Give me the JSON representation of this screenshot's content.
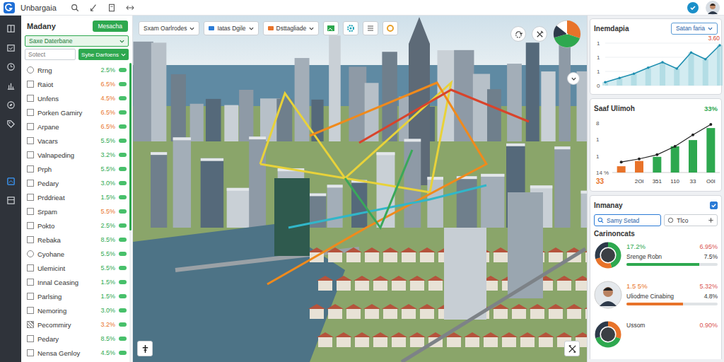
{
  "window": {
    "title": "Unbargaia"
  },
  "rail": [
    {
      "selected": false
    },
    {
      "selected": false
    },
    {
      "selected": false
    },
    {
      "selected": false
    },
    {
      "selected": false
    },
    {
      "selected": false
    },
    {
      "selected": true
    },
    {
      "selected": false
    }
  ],
  "left_panel": {
    "title": "Madany",
    "button": "Mesacha",
    "filter": "Saxe Daterbane",
    "search": {
      "placeholder": "Sotect"
    },
    "dropdown": "Sybe Darfoens",
    "scroll_level": 0.56,
    "items": [
      {
        "kind": "radio",
        "name": "Rrng",
        "value": "2.5%",
        "color": "#2ea84f",
        "checked": false
      },
      {
        "kind": "checkbox",
        "name": "Raiot",
        "value": "6.5%",
        "color": "#e8732a",
        "checked": false
      },
      {
        "kind": "checkbox",
        "name": "Unfens",
        "value": "4.5%",
        "color": "#e8732a",
        "checked": false
      },
      {
        "kind": "checkbox",
        "name": "Porken Gamiry",
        "value": "6.5%",
        "color": "#e8732a",
        "checked": false
      },
      {
        "kind": "checkbox",
        "name": "Arpane",
        "value": "6.5%",
        "color": "#e8732a",
        "checked": false
      },
      {
        "kind": "checkbox",
        "name": "Vacars",
        "value": "5.5%",
        "color": "#2ea84f",
        "checked": false
      },
      {
        "kind": "checkbox",
        "name": "Valnapeding",
        "value": "3.2%",
        "color": "#2ea84f",
        "checked": false
      },
      {
        "kind": "checkbox",
        "name": "Prph",
        "value": "5.5%",
        "color": "#2ea84f",
        "checked": false
      },
      {
        "kind": "checkbox",
        "name": "Pedary",
        "value": "3.0%",
        "color": "#2ea84f",
        "checked": false
      },
      {
        "kind": "checkbox",
        "name": "Prddrieat",
        "value": "1.5%",
        "color": "#2ea84f",
        "checked": false
      },
      {
        "kind": "checkbox",
        "name": "Srpam",
        "value": "5.5%",
        "color": "#e8732a",
        "checked": false
      },
      {
        "kind": "checkbox",
        "name": "Pokto",
        "value": "2.5%",
        "color": "#2ea84f",
        "checked": false
      },
      {
        "kind": "checkbox",
        "name": "Rebaka",
        "value": "8.5%",
        "color": "#2ea84f",
        "checked": false
      },
      {
        "kind": "radio",
        "name": "Cyohane",
        "value": "5.5%",
        "color": "#2ea84f",
        "checked": false
      },
      {
        "kind": "checkbox",
        "name": "Ulemicint",
        "value": "5.5%",
        "color": "#2ea84f",
        "checked": false
      },
      {
        "kind": "checkbox",
        "name": "Innal Ceasing",
        "value": "1.5%",
        "color": "#2ea84f",
        "checked": false
      },
      {
        "kind": "checkbox",
        "name": "Parlsing",
        "value": "1.5%",
        "color": "#2ea84f",
        "checked": false
      },
      {
        "kind": "checkbox",
        "name": "Nemoring",
        "value": "3.0%",
        "color": "#2ea84f",
        "checked": false
      },
      {
        "kind": "checkbox",
        "name": "Pecommiry",
        "value": "3.2%",
        "color": "#e8732a",
        "checked": true
      },
      {
        "kind": "checkbox",
        "name": "Pedary",
        "value": "8.5%",
        "color": "#2ea84f",
        "checked": false
      },
      {
        "kind": "checkbox",
        "name": "Nensa Genloy",
        "value": "4.5%",
        "color": "#2ea84f",
        "checked": false
      }
    ]
  },
  "map": {
    "toolbar": [
      {
        "label": "Sxam Oarlrodes"
      },
      {
        "label": "Iatas Dgile",
        "color": "#2b7bd6"
      },
      {
        "label": "Dsttagliade",
        "color": "#e8732a"
      }
    ],
    "overview_pie": [
      {
        "value": 0.3,
        "color": "#e8732a"
      },
      {
        "value": 0.4,
        "color": "#2ea84f"
      },
      {
        "value": 0.15,
        "color": "#2d3a4a"
      }
    ]
  },
  "right_panel": {
    "trend": {
      "title": "Inemdapia",
      "dropdown": "Satan faria",
      "highlight": "3.60",
      "ticks": [
        "1",
        "1",
        "1",
        "0"
      ],
      "values": [
        0.08,
        0.18,
        0.28,
        0.42,
        0.55,
        0.4,
        0.78,
        0.62,
        0.95
      ]
    },
    "growth": {
      "title": "Saaf Ulimoh",
      "change": "33%",
      "ticks": [
        "8",
        "1",
        "1",
        "14 %"
      ],
      "total": "33",
      "bars": [
        {
          "value": 0.12,
          "color": "#e8732a"
        },
        {
          "value": 0.22,
          "color": "#e8732a"
        },
        {
          "value": 0.3,
          "color": "#2ea84f"
        },
        {
          "value": 0.5,
          "color": "#2ea84f"
        },
        {
          "value": 0.62,
          "color": "#2ea84f"
        },
        {
          "value": 0.85,
          "color": "#2ea84f"
        }
      ],
      "line": [
        0.2,
        0.26,
        0.34,
        0.5,
        0.72,
        0.92
      ],
      "x_labels": [
        "2Ol",
        "351",
        "110",
        "33",
        "O0l"
      ]
    },
    "filters": {
      "title": "Inmanay",
      "checked": true,
      "search": {
        "value": "Samy Setad"
      },
      "second": {
        "value": "Tlco"
      }
    },
    "components": {
      "title": "Carinoncats",
      "items": [
        {
          "kind": "donut",
          "share": "17.2%",
          "share_color": "#2ea84f",
          "name": "Srenge Robn",
          "delta": "6.95%",
          "delta_color": "#d9534f",
          "amount": "7.5%",
          "level": 0.8,
          "bar_color": "#2ea84f",
          "segments": [
            {
              "value": 0.45,
              "color": "#2ea84f"
            },
            {
              "value": 0.25,
              "color": "#e8732a"
            },
            {
              "value": 0.3,
              "color": "#2d3a4a"
            }
          ]
        },
        {
          "kind": "avatar",
          "share": "1.5 5%",
          "share_color": "#e8732a",
          "name": "Uliodme Cinabing",
          "delta": "5.32%",
          "delta_color": "#d9534f",
          "amount": "4.8%",
          "level": 0.62,
          "bar_color": "#e8732a"
        },
        {
          "kind": "donut",
          "name": "Ussom",
          "delta": "0.90%",
          "delta_color": "#d9534f",
          "segments": [
            {
              "value": 0.3,
              "color": "#e8732a"
            },
            {
              "value": 0.4,
              "color": "#2ea84f"
            },
            {
              "value": 0.3,
              "color": "#2d3a4a"
            }
          ]
        }
      ]
    }
  }
}
